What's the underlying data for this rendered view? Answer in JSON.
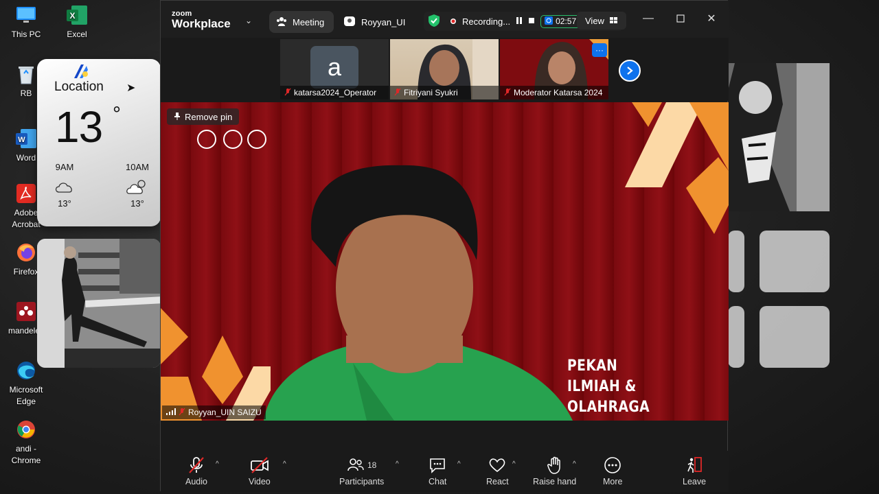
{
  "desktop": {
    "icons": [
      {
        "label": "This PC"
      },
      {
        "label": "Excel"
      },
      {
        "label": "RB"
      },
      {
        "label": "Word"
      },
      {
        "label": "Adobe Acrobat"
      },
      {
        "label": "Firefox"
      },
      {
        "label": "mandeley"
      },
      {
        "label": "Microsoft Edge"
      },
      {
        "label": "andi - Chrome"
      }
    ]
  },
  "weather": {
    "location": "Location",
    "temperature": "13",
    "degree": "°",
    "forecast": [
      {
        "time": "9AM",
        "condition": "cloudy-icon",
        "temp": "13°"
      },
      {
        "time": "10AM",
        "condition": "partly-cloudy-icon",
        "temp": "13°"
      }
    ]
  },
  "zoom": {
    "logo_top": "zoom",
    "logo_bottom": "Workplace",
    "tabs": [
      {
        "label": "Meeting"
      },
      {
        "label": "Royyan_UI"
      }
    ],
    "recording_label": "Recording...",
    "timer": "02:57",
    "view_label": "View",
    "thumbnails": [
      {
        "name": "katarsa2024_Operator",
        "avatar_letter": "a"
      },
      {
        "name": "Fitriyani Syukri"
      },
      {
        "name": "Moderator Katarsa 2024"
      }
    ],
    "remove_pin": "Remove pin",
    "active_speaker": "Royyan_UIN SAIZU",
    "event_line1": "PEKAN",
    "event_line2": "ILMIAH & OLAHRAGA",
    "toolbar": {
      "audio": "Audio",
      "video": "Video",
      "participants": "Participants",
      "participants_count": "18",
      "chat": "Chat",
      "react": "React",
      "raise_hand": "Raise hand",
      "more": "More",
      "leave": "Leave"
    },
    "colors": {
      "accent": "#0e72ed",
      "leave": "#e02828",
      "recording": "#e02828",
      "shield": "#23c16b"
    }
  }
}
